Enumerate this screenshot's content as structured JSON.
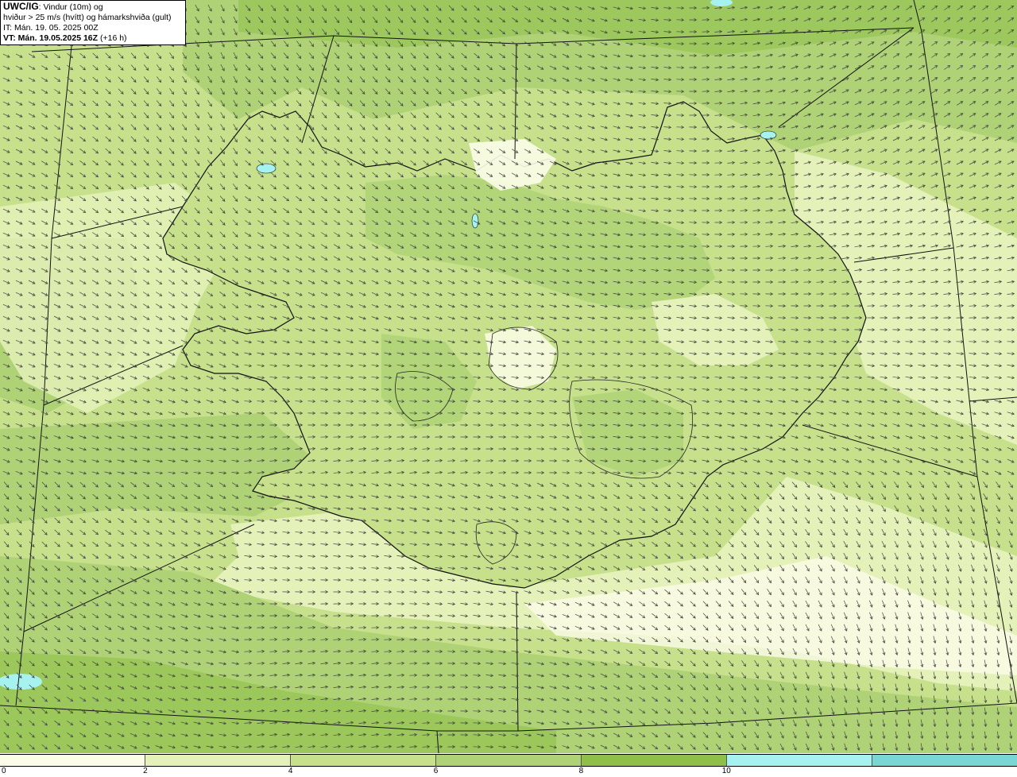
{
  "info": {
    "model": "UWC/IG",
    "line1_rest": ": Vindur (10m) og",
    "line2": "hviður > 25 m/s (hvítt) og hámarkshviða (gult)",
    "line3": "IT: Mán. 19. 05. 2025 00Z",
    "line4_bold": "VT: Mán. 19.05.2025 16Z",
    "line4_rest": " (+16 h)"
  },
  "legend": {
    "labels": [
      "0",
      "2",
      "4",
      "6",
      "8",
      "10"
    ],
    "colors": [
      "#fbfde8",
      "#e4f1b8",
      "#c6e08c",
      "#aed275",
      "#8fbf48",
      "#a6f2f0",
      "#79d6d2"
    ]
  },
  "map": {
    "colors": {
      "wind_0_2": "#fbfde8",
      "wind_2_4": "#e4f1b8",
      "wind_4_6": "#c6e08c",
      "wind_6_8": "#aed275",
      "wind_8_10": "#8fbf48",
      "wind_10_12": "#a6f2f0",
      "water": "#a6f2f0",
      "coastline": "#000000",
      "arrows": "#444444"
    }
  }
}
